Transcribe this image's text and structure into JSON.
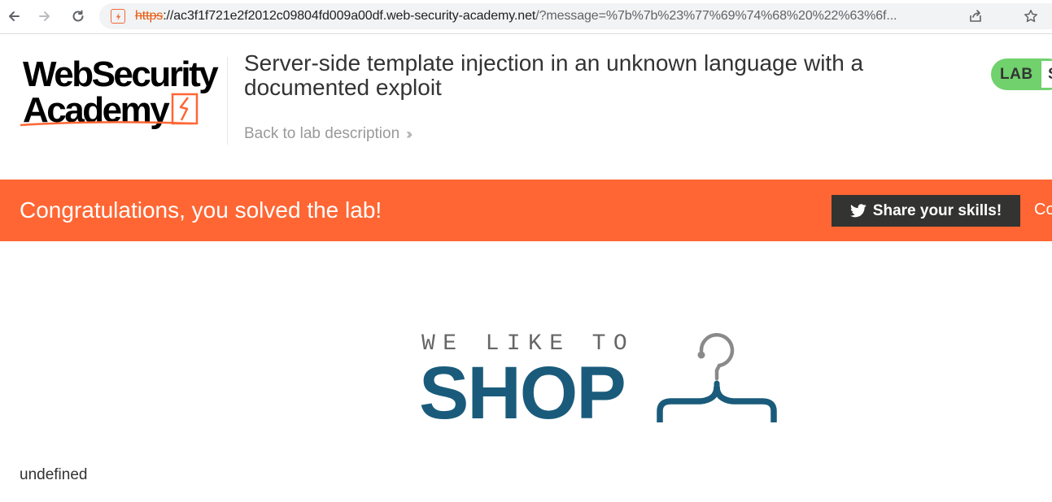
{
  "browser": {
    "url_scheme": "https",
    "url_rest": "://ac3f1f721e2f2012c09804fd009a00df.web-security-academy.net",
    "url_query": "/?message=%7b%7b%23%77%69%74%68%20%22%63%6f..."
  },
  "header": {
    "logo_line1": "WebSecurity",
    "logo_line2": "Academy",
    "lab_title": "Server-side template injection in an unknown language with a documented exploit",
    "back_link": "Back to lab description",
    "lab_badge": "LAB",
    "lab_status_partial": "S"
  },
  "banner": {
    "message": "Congratulations, you solved the lab!",
    "share_label": "Share your skills!",
    "continue_partial": "Co"
  },
  "shop": {
    "tagline": "WE LIKE TO",
    "word": "SHOP"
  },
  "content": {
    "text": "undefined"
  },
  "colors": {
    "accent": "#ff6633",
    "shop_blue": "#1a5b7b",
    "lab_green": "#70d16d"
  }
}
